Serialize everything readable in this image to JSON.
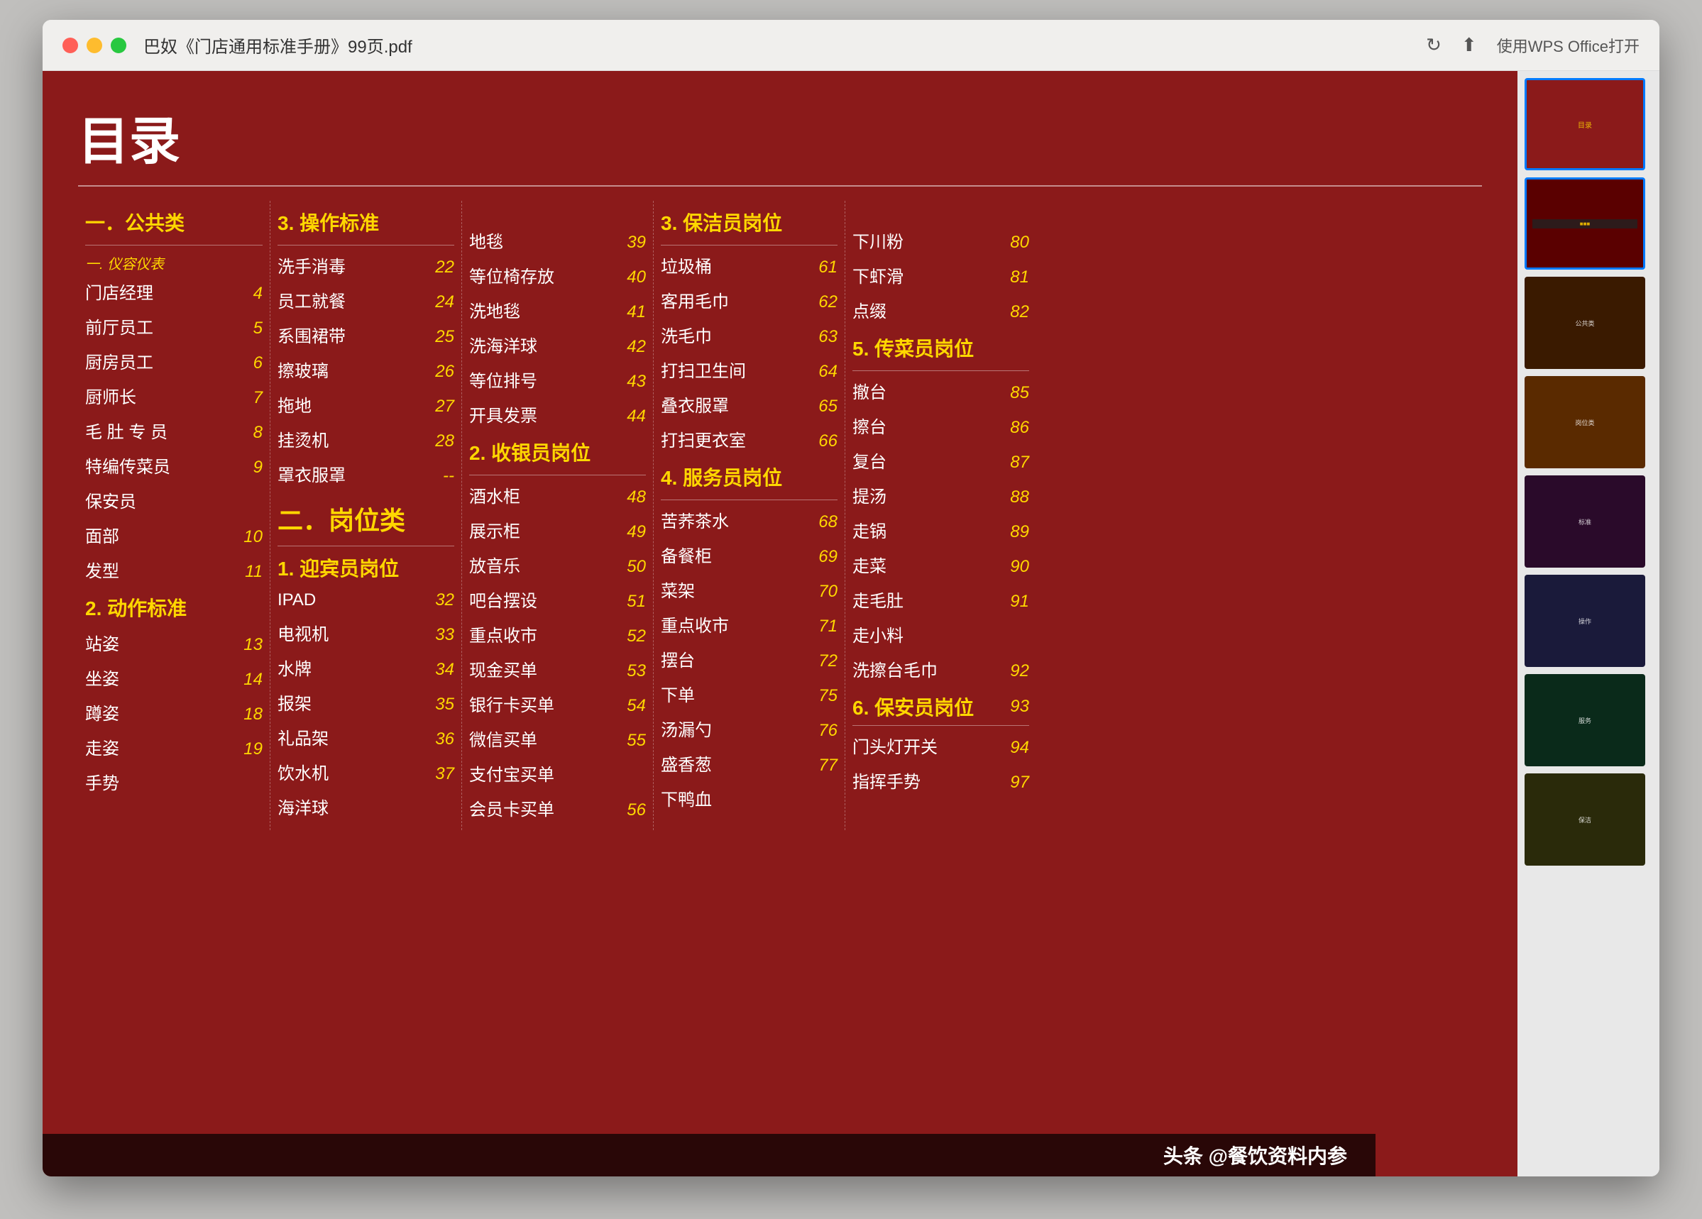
{
  "window": {
    "title": "巴奴《门店通用标准手册》99页.pdf",
    "wps_button": "使用WPS Office打开"
  },
  "toc": {
    "title": "目录",
    "sections": [
      {
        "id": "col1",
        "items": [
          {
            "section": "一．公共类",
            "is_section": true
          },
          {
            "name": "门店经理",
            "page": "4"
          },
          {
            "name": "前厅员工",
            "page": "5"
          },
          {
            "name": "厨房员工",
            "page": "6"
          },
          {
            "name": "厨师长",
            "page": "7"
          },
          {
            "name": "毛 肚 专 员",
            "page": "8"
          },
          {
            "name": "特编传菜员",
            "page": "9"
          },
          {
            "name": "保安员",
            "page": ""
          },
          {
            "name": "",
            "page": "10"
          },
          {
            "name": "面部",
            "page": ""
          },
          {
            "name": "",
            "page": "11"
          },
          {
            "name": "发型",
            "page": ""
          },
          {
            "section": "2. 动作标准",
            "is_section": true
          },
          {
            "name": "站姿",
            "page": "13"
          },
          {
            "name": "坐姿",
            "page": "14"
          },
          {
            "name": "蹲姿",
            "page": "18"
          },
          {
            "name": "走姿",
            "page": "19"
          },
          {
            "name": "手势",
            "page": ""
          }
        ]
      },
      {
        "id": "col2",
        "items": [
          {
            "section": "3. 操作标准",
            "is_section": true
          },
          {
            "name": "洗手消毒",
            "page": "22"
          },
          {
            "name": "员工就餐",
            "page": "24"
          },
          {
            "name": "系围裙带",
            "page": "25"
          },
          {
            "name": "擦玻璃",
            "page": "26"
          },
          {
            "name": "拖地",
            "page": "27"
          },
          {
            "name": "挂烫机",
            "page": "28"
          },
          {
            "name": "罩衣服罩",
            "page": ""
          },
          {
            "section": "二．岗位类",
            "is_section": true
          },
          {
            "section": "1. 迎宾员岗位",
            "is_section": true
          },
          {
            "name": "IPAD",
            "page": "32"
          },
          {
            "name": "电视机",
            "page": "33"
          },
          {
            "name": "水牌",
            "page": "34"
          },
          {
            "name": "报架",
            "page": "35"
          },
          {
            "name": "礼品架",
            "page": "36"
          },
          {
            "name": "饮水机",
            "page": "37"
          },
          {
            "name": "海洋球",
            "page": ""
          }
        ]
      },
      {
        "id": "col3",
        "items": [
          {
            "name": "地毯",
            "page": "39"
          },
          {
            "name": "等位椅存放",
            "page": "40"
          },
          {
            "name": "洗地毯",
            "page": "41"
          },
          {
            "name": "洗海洋球",
            "page": "42"
          },
          {
            "name": "等位排号",
            "page": "43"
          },
          {
            "name": "开具发票",
            "page": "44"
          },
          {
            "section": "2. 收银员岗位",
            "is_section": true
          },
          {
            "name": "酒水柜",
            "page": "48"
          },
          {
            "name": "展示柜",
            "page": "49"
          },
          {
            "name": "放音乐",
            "page": "50"
          },
          {
            "name": "吧台摆设",
            "page": "51"
          },
          {
            "name": "重点收市",
            "page": "52"
          },
          {
            "name": "现金买单",
            "page": "53"
          },
          {
            "name": "银行卡买单",
            "page": "54"
          },
          {
            "name": "微信买单",
            "page": "55"
          },
          {
            "name": "支付宝买单",
            "page": ""
          },
          {
            "name": "会员卡买单",
            "page": "56"
          }
        ]
      },
      {
        "id": "col4",
        "items": [
          {
            "section": "3. 保洁员岗位",
            "is_section": true
          },
          {
            "name": "垃圾桶",
            "page": "61"
          },
          {
            "name": "客用毛巾",
            "page": "62"
          },
          {
            "name": "洗毛巾",
            "page": "63"
          },
          {
            "name": "打扫卫生间",
            "page": "64"
          },
          {
            "name": "叠衣服罩",
            "page": "65"
          },
          {
            "name": "打扫更衣室",
            "page": "66"
          },
          {
            "section": "4. 服务员岗位",
            "is_section": true
          },
          {
            "name": "苦荞茶水",
            "page": "68"
          },
          {
            "name": "备餐柜",
            "page": "69"
          },
          {
            "name": "菜架",
            "page": "70"
          },
          {
            "name": "重点收市",
            "page": "71"
          },
          {
            "name": "摆台",
            "page": "72"
          },
          {
            "name": "下单",
            "page": "75"
          },
          {
            "name": "汤漏勺",
            "page": "76"
          },
          {
            "name": "盛香葱",
            "page": "77"
          },
          {
            "name": "下鸭血",
            "page": ""
          }
        ]
      },
      {
        "id": "col5",
        "items": [
          {
            "name": "下川粉",
            "page": "80"
          },
          {
            "name": "下虾滑",
            "page": "81"
          },
          {
            "name": "点缀",
            "page": "82"
          },
          {
            "section": "5. 传菜员岗位",
            "is_section": true
          },
          {
            "name": "撤台",
            "page": "85"
          },
          {
            "name": "擦台",
            "page": "86"
          },
          {
            "name": "复台",
            "page": "87"
          },
          {
            "name": "提汤",
            "page": "88"
          },
          {
            "name": "走锅",
            "page": "89"
          },
          {
            "name": "走菜",
            "page": "90"
          },
          {
            "name": "走毛肚",
            "page": "91"
          },
          {
            "name": "走小料",
            "page": ""
          },
          {
            "name": "洗擦台毛巾",
            "page": "92"
          },
          {
            "section": "6. 保安员岗位",
            "is_section": true,
            "page": "93"
          },
          {
            "name": "门头灯开关",
            "page": "94"
          },
          {
            "name": "指挥手势",
            "page": "97"
          }
        ]
      }
    ]
  },
  "footer": {
    "text": "头条 @餐饮资料内参"
  }
}
